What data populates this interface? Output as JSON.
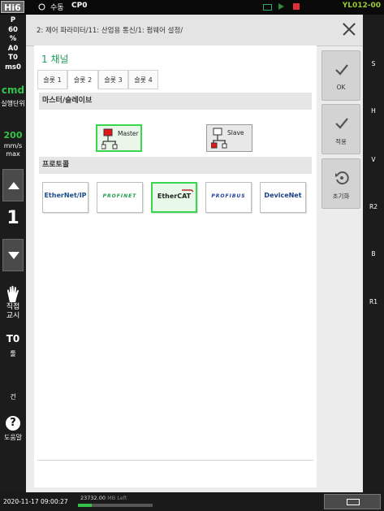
{
  "topbar": {
    "logo": "Hi6",
    "mode": "수동",
    "program": "CP0",
    "job": "YL012-00",
    "indicator_colors": [
      "#3a6",
      "#2f8a3c",
      "#e0303a"
    ]
  },
  "left": {
    "status_lines": [
      "P",
      "60",
      "%",
      "A0",
      "T0",
      "ms0"
    ],
    "cmd": "cmd",
    "exec_unit": "실행단위",
    "speed_value": "200",
    "speed_unit": "mm/s",
    "speed_limit": "max",
    "step_number": "1",
    "direct_teach": "직접\n교시",
    "tool_value": "T0",
    "tool_label": "툴",
    "gun_label": "건",
    "help_label": "도움말"
  },
  "right": {
    "labels": [
      "S",
      "H",
      "V",
      "R2",
      "B",
      "R1"
    ]
  },
  "header": {
    "breadcrumb": "2: 제어 파라미터/11: 산업용 통신/1: 펌웨어 설정/"
  },
  "content": {
    "channel_title": "1 채널",
    "tabs": [
      {
        "label": "슬롯 1",
        "active": false
      },
      {
        "label": "슬롯 2",
        "active": true
      },
      {
        "label": "슬롯 3",
        "active": false
      },
      {
        "label": "슬롯 4",
        "active": false
      }
    ],
    "master_slave_section": "마스터/슬레이브",
    "master_label": "Master",
    "slave_label": "Slave",
    "selected_role": "Master",
    "protocol_section": "프로토콜",
    "protocols": [
      "EtherNet/IP",
      "PROFINET",
      "EtherCAT",
      "PROFIBUS",
      "DeviceNet"
    ],
    "selected_protocol": "EtherCAT"
  },
  "actions": {
    "ok": "OK",
    "apply": "적용",
    "reset": "초기화"
  },
  "bottombar": {
    "datetime": "2020-11-17 09:00:27",
    "memory_value": "23732.00",
    "memory_unit": "MB Left",
    "memory_fill_fraction": 0.18
  }
}
